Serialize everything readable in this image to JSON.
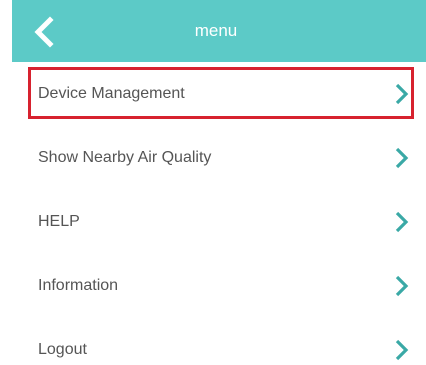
{
  "header": {
    "back_icon": "chevron-left-icon",
    "title": "menu",
    "background_color": "#5ccac7"
  },
  "menu": {
    "selected_index": 0,
    "highlight_color": "#d7222f",
    "chevron_color": "#3aa9a6",
    "items": [
      {
        "label": "Device Management",
        "icon": "chevron-right-icon"
      },
      {
        "label": "Show Nearby Air Quality",
        "icon": "chevron-right-icon"
      },
      {
        "label": "HELP",
        "icon": "chevron-right-icon"
      },
      {
        "label": "Information",
        "icon": "chevron-right-icon"
      },
      {
        "label": "Logout",
        "icon": "chevron-right-icon"
      }
    ]
  }
}
